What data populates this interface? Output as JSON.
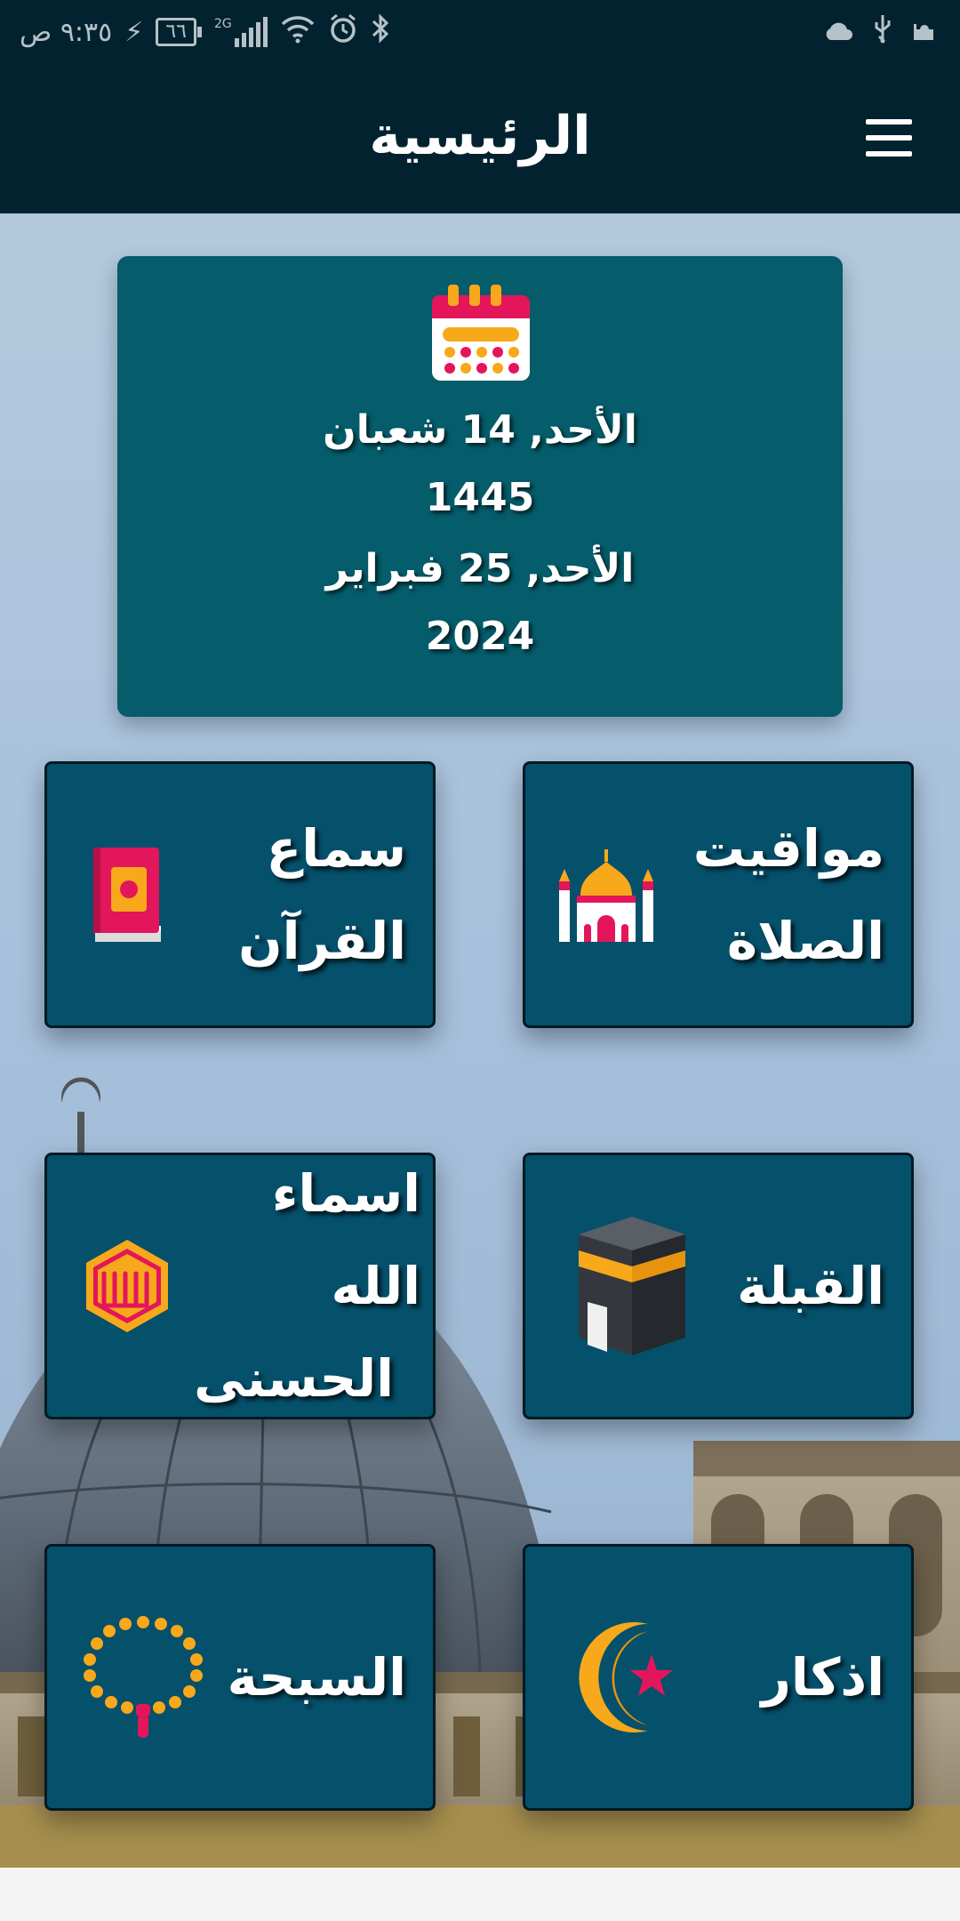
{
  "status_bar": {
    "time": "٩:٣٥ ص",
    "battery": "٦٦",
    "network": "2G"
  },
  "header": {
    "title": "الرئيسية"
  },
  "date_card": {
    "hijri_day": "الأحد, 14 شعبان",
    "hijri_year": "1445",
    "gregorian_day": "الأحد, 25 فبراير",
    "gregorian_year": "2024"
  },
  "tiles": [
    {
      "label_line1": "مواقيت",
      "label_line2": "الصلاة",
      "icon": "mosque-icon"
    },
    {
      "label_line1": "سماع",
      "label_line2": "القرآن",
      "icon": "quran-book-icon"
    },
    {
      "label_line1": "القبلة",
      "label_line2": "",
      "icon": "kaaba-icon"
    },
    {
      "label_line1": "اسماء الله",
      "label_line2": "الحسنى",
      "icon": "allah-names-icon"
    },
    {
      "label_line1": "اذكار",
      "label_line2": "",
      "icon": "crescent-star-icon"
    },
    {
      "label_line1": "السبحة",
      "label_line2": "",
      "icon": "prayer-beads-icon"
    }
  ],
  "colors": {
    "status_bar": "#03222f",
    "card": "#055c6a",
    "tile": "#05506b"
  }
}
